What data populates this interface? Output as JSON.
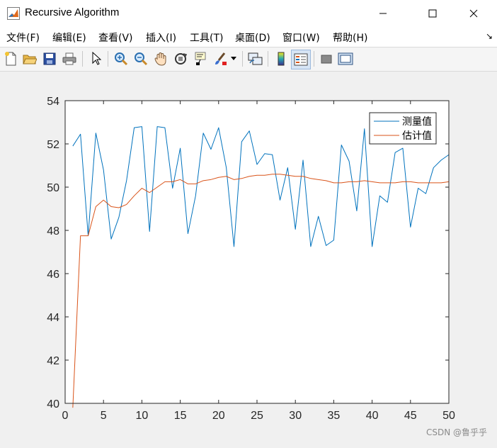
{
  "window": {
    "title": "Recursive Algorithm"
  },
  "menu": [
    {
      "label": "文件(F)"
    },
    {
      "label": "编辑(E)"
    },
    {
      "label": "查看(V)"
    },
    {
      "label": "插入(I)"
    },
    {
      "label": "工具(T)"
    },
    {
      "label": "桌面(D)"
    },
    {
      "label": "窗口(W)"
    },
    {
      "label": "帮助(H)"
    }
  ],
  "toolbar": [
    "new-figure-icon",
    "open-file-icon",
    "save-icon",
    "print-icon",
    "pointer-icon",
    "zoom-in-icon",
    "zoom-out-icon",
    "pan-icon",
    "rotate-3d-icon",
    "data-cursor-icon",
    "brush-icon",
    "link-plot-icon",
    "colorbar-icon",
    "legend-icon",
    "hide-plot-tools-icon",
    "show-plot-tools-icon"
  ],
  "watermark": "CSDN @鲁乎乎",
  "chart_data": {
    "type": "line",
    "title": "",
    "xlabel": "",
    "ylabel": "",
    "xlim": [
      0,
      50
    ],
    "ylim": [
      40,
      54
    ],
    "xticks": [
      "0",
      "5",
      "10",
      "15",
      "20",
      "25",
      "30",
      "35",
      "40",
      "45",
      "50"
    ],
    "yticks": [
      "40",
      "42",
      "44",
      "46",
      "48",
      "50",
      "52",
      "54"
    ],
    "grid": false,
    "legend_position": "top-right",
    "x": [
      1,
      2,
      3,
      4,
      5,
      6,
      7,
      8,
      9,
      10,
      11,
      12,
      13,
      14,
      15,
      16,
      17,
      18,
      19,
      20,
      21,
      22,
      23,
      24,
      25,
      26,
      27,
      28,
      29,
      30,
      31,
      32,
      33,
      34,
      35,
      36,
      37,
      38,
      39,
      40,
      41,
      42,
      43,
      44,
      45,
      46,
      47,
      48,
      49,
      50
    ],
    "series": [
      {
        "name": "测量值",
        "color": "#0072bd",
        "values": [
          51.9,
          52.45,
          47.75,
          52.5,
          50.8,
          47.6,
          48.6,
          50.3,
          52.75,
          52.8,
          47.95,
          52.8,
          52.75,
          49.95,
          51.8,
          47.85,
          49.6,
          52.5,
          51.75,
          52.75,
          50.9,
          47.25,
          52.1,
          52.6,
          51.05,
          51.55,
          51.5,
          49.4,
          50.9,
          48.05,
          51.25,
          47.25,
          48.65,
          47.3,
          47.55,
          51.95,
          51.2,
          48.9,
          52.7,
          47.25,
          49.6,
          49.3,
          51.6,
          51.8,
          48.15,
          49.95,
          49.7,
          50.9,
          51.25,
          51.5
        ]
      },
      {
        "name": "估计值",
        "color": "#d95319",
        "values": [
          39.8,
          47.75,
          47.75,
          49.1,
          49.4,
          49.1,
          49.05,
          49.2,
          49.6,
          49.95,
          49.75,
          50.0,
          50.25,
          50.25,
          50.35,
          50.15,
          50.15,
          50.3,
          50.35,
          50.45,
          50.5,
          50.35,
          50.4,
          50.5,
          50.55,
          50.55,
          50.6,
          50.6,
          50.55,
          50.5,
          50.5,
          50.4,
          50.35,
          50.3,
          50.2,
          50.2,
          50.25,
          50.25,
          50.3,
          50.25,
          50.2,
          50.2,
          50.2,
          50.25,
          50.25,
          50.2,
          50.2,
          50.2,
          50.2,
          50.25
        ]
      }
    ]
  }
}
